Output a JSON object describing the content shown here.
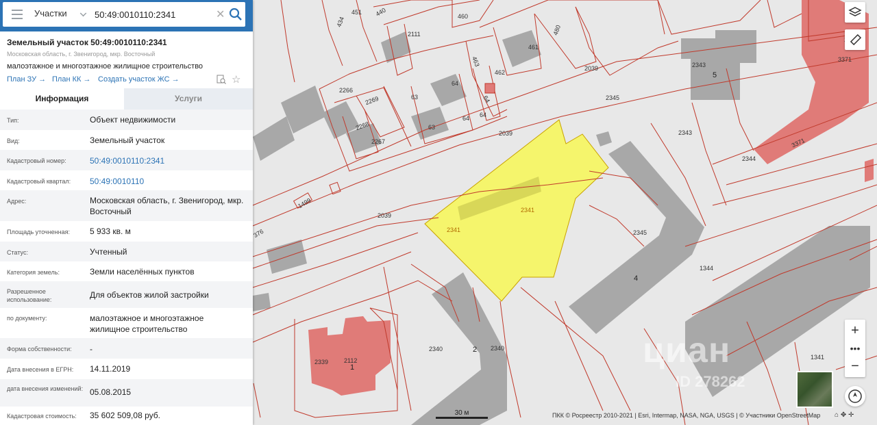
{
  "search": {
    "type_label": "Участки",
    "query": "50:49:0010110:2341"
  },
  "card": {
    "title": "Земельный участок 50:49:0010110:2341",
    "address_small": "Московская область, г. Звенигород, мкр. Восточный",
    "purpose": "малоэтажное и многоэтажное жилищное строительство",
    "links": [
      "План ЗУ →",
      "План КК →",
      "Создать участок ЖС →"
    ]
  },
  "tabs": {
    "info": "Информация",
    "services": "Услуги"
  },
  "info_rows": [
    {
      "label": "Тип:",
      "value": "Объект недвижимости"
    },
    {
      "label": "Вид:",
      "value": "Земельный участок"
    },
    {
      "label": "Кадастровый номер:",
      "value": "50:49:0010110:2341"
    },
    {
      "label": "Кадастровый квартал:",
      "value": "50:49:0010110"
    },
    {
      "label": "Адрес:",
      "value": "Московская область, г. Звенигород, мкр. Восточный"
    },
    {
      "label": "Площадь уточненная:",
      "value": "5 933 кв. м"
    },
    {
      "label": "Статус:",
      "value": "Учтенный"
    },
    {
      "label": "Категория земель:",
      "value": "Земли населённых пунктов"
    },
    {
      "label": "Разрешенное использование:",
      "value": "Для объектов жилой застройки"
    },
    {
      "label": "по документу:",
      "value": "малоэтажное и многоэтажное жилищное строительство"
    },
    {
      "label": "Форма собственности:",
      "value": "-"
    },
    {
      "label": "Дата внесения в ЕГРН:",
      "value": "14.11.2019"
    },
    {
      "label": "дата внесения изменений:",
      "value": "05.08.2015"
    },
    {
      "label": "Кадастровая стоимость:",
      "value": "35 602 509,08 руб."
    }
  ],
  "map": {
    "parcel_labels": [
      "451",
      "440",
      "460",
      "434",
      "2111",
      "480",
      "461",
      "463",
      "462",
      "2039",
      "2344",
      "3371",
      "2343",
      "2266",
      "2269",
      "2268",
      "2267",
      "63",
      "64",
      "2345",
      "1499",
      "2341",
      "2340",
      "2339",
      "2112",
      "1344",
      "1341",
      "376"
    ],
    "building_labels": [
      "5",
      "4",
      "2",
      "1"
    ],
    "scale": "30 м",
    "attribution": "ПКК © Росреестр 2010-2021 | Esri, Intermap, NASA, NGA, USGS | © Участники OpenStreetMap",
    "watermark": "циан",
    "watermark_id": "ID 278262"
  },
  "colors": {
    "accent": "#2c73b5",
    "parcel_line": "#c0392b",
    "selected_parcel": "#f5f56c",
    "building": "#a9a9a9",
    "building_highlight": "#e07b78"
  },
  "icons": [
    "menu-icon",
    "chevron-down-icon",
    "close-icon",
    "search-icon",
    "collapse-icon",
    "document-search-icon",
    "star-icon",
    "layers-icon",
    "ruler-icon",
    "zoom-in-icon",
    "more-icon",
    "zoom-out-icon",
    "compass-icon",
    "home-icon",
    "locate-icon",
    "plus-icon"
  ]
}
